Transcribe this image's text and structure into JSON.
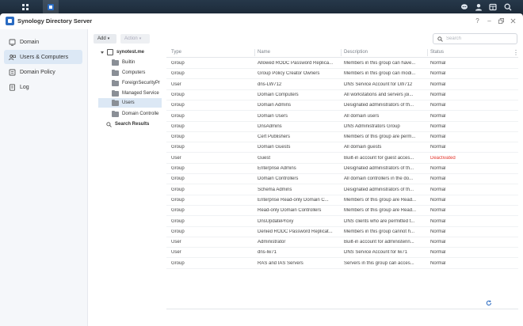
{
  "window": {
    "title": "Synology Directory Server"
  },
  "nav": {
    "items": [
      {
        "label": "Domain",
        "icon": "domain-icon"
      },
      {
        "label": "Users & Computers",
        "icon": "users-computers-icon"
      },
      {
        "label": "Domain Policy",
        "icon": "domain-policy-icon"
      },
      {
        "label": "Log",
        "icon": "log-icon"
      }
    ],
    "active_index": 1
  },
  "toolbar": {
    "add_label": "Add",
    "action_label": "Action"
  },
  "search": {
    "placeholder": "Search"
  },
  "tree": {
    "root": "synotest.me",
    "children": [
      "Builtin",
      "Computers",
      "ForeignSecurityPr",
      "Managed Service",
      "Users",
      "Domain Controlle"
    ],
    "selected": "Users",
    "search_results": "Search Results"
  },
  "table": {
    "headers": {
      "type": "Type",
      "name": "Name",
      "description": "Description",
      "status": "Status"
    },
    "rows": [
      {
        "type": "Group",
        "name": "Allowed RODC Password Replica...",
        "description": "Members in this group can have...",
        "status": "Normal"
      },
      {
        "type": "Group",
        "name": "Group Policy Creator Owners",
        "description": "Members in this group can modi...",
        "status": "Normal"
      },
      {
        "type": "User",
        "name": "dns-LW712",
        "description": "DNS Service Account for LW712",
        "status": "Normal"
      },
      {
        "type": "Group",
        "name": "Domain Computers",
        "description": "All workstations and servers joi...",
        "status": "Normal"
      },
      {
        "type": "Group",
        "name": "Domain Admins",
        "description": "Designated administrators of th...",
        "status": "Normal"
      },
      {
        "type": "Group",
        "name": "Domain Users",
        "description": "All domain users",
        "status": "Normal"
      },
      {
        "type": "Group",
        "name": "DnsAdmins",
        "description": "DNS Administrators Group",
        "status": "Normal"
      },
      {
        "type": "Group",
        "name": "Cert Publishers",
        "description": "Members of this group are perm...",
        "status": "Normal"
      },
      {
        "type": "Group",
        "name": "Domain Guests",
        "description": "All domain guests",
        "status": "Normal"
      },
      {
        "type": "User",
        "name": "Guest",
        "description": "Built-in account for guest acces...",
        "status": "Deactivated"
      },
      {
        "type": "Group",
        "name": "Enterprise Admins",
        "description": "Designated administrators of th...",
        "status": "Normal"
      },
      {
        "type": "Group",
        "name": "Domain Controllers",
        "description": "All domain controllers in the do...",
        "status": "Normal"
      },
      {
        "type": "Group",
        "name": "Schema Admins",
        "description": "Designated administrators of th...",
        "status": "Normal"
      },
      {
        "type": "Group",
        "name": "Enterprise Read-only Domain C...",
        "description": "Members of this group are Read...",
        "status": "Normal"
      },
      {
        "type": "Group",
        "name": "Read-only Domain Controllers",
        "description": "Members of this group are Read...",
        "status": "Normal"
      },
      {
        "type": "Group",
        "name": "DnsUpdateProxy",
        "description": "DNS clients who are permitted t...",
        "status": "Normal"
      },
      {
        "type": "Group",
        "name": "Denied RODC Password Replicat...",
        "description": "Members in this group cannot h...",
        "status": "Normal"
      },
      {
        "type": "User",
        "name": "Administrator",
        "description": "Built-in account for administerin...",
        "status": "Normal"
      },
      {
        "type": "User",
        "name": "dns-lw71",
        "description": "DNS Service Account for lw71",
        "status": "Normal"
      },
      {
        "type": "Group",
        "name": "RAS and IAS Servers",
        "description": "Servers in this group can acces...",
        "status": "Normal"
      }
    ]
  },
  "colors": {
    "accent": "#2a6bc2",
    "deactivated": "#e2352b",
    "selected_bg": "#dce8f5"
  }
}
